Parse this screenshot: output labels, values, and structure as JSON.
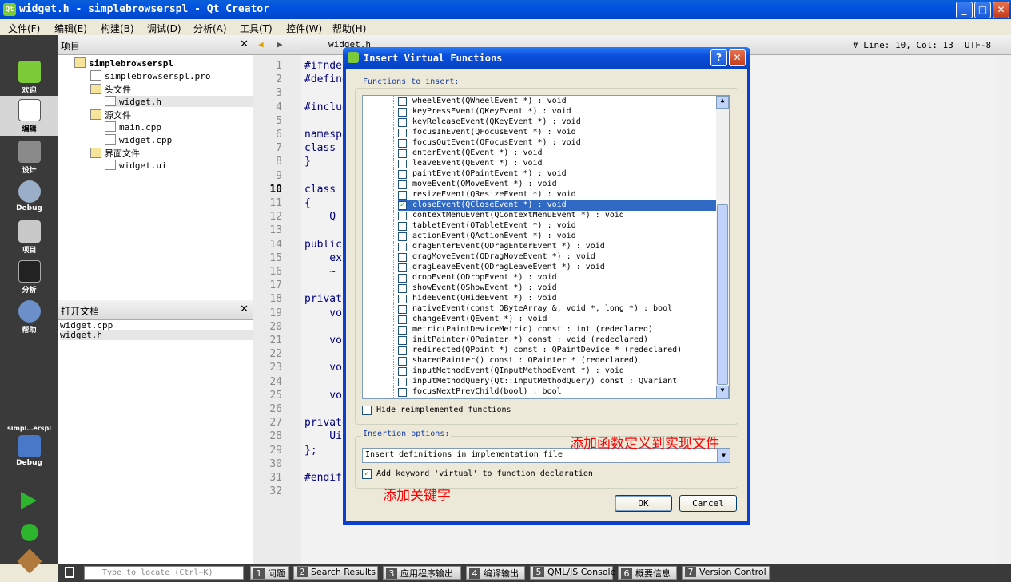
{
  "window": {
    "title": "widget.h - simplebrowserspl - Qt Creator",
    "icon": "qt-icon"
  },
  "menu": [
    "文件(F)",
    "编辑(E)",
    "构建(B)",
    "调试(D)",
    "分析(A)",
    "工具(T)",
    "控件(W)",
    "帮助(H)"
  ],
  "modes": [
    {
      "label": "欢迎",
      "icon": "welcome-icon"
    },
    {
      "label": "编辑",
      "icon": "edit-icon"
    },
    {
      "label": "设计",
      "icon": "design-icon"
    },
    {
      "label": "Debug",
      "icon": "debug-icon"
    },
    {
      "label": "项目",
      "icon": "project-icon"
    },
    {
      "label": "分析",
      "icon": "analyze-icon"
    },
    {
      "label": "帮助",
      "icon": "help-icon"
    }
  ],
  "target": {
    "name": "simpl…erspl",
    "mode": "Debug"
  },
  "projects": {
    "title": "项目",
    "tree": [
      {
        "label": "simplebrowserspl",
        "level": 0
      },
      {
        "label": "simplebrowserspl.pro",
        "level": 1
      },
      {
        "label": "头文件",
        "level": 1
      },
      {
        "label": "widget.h",
        "level": 2
      },
      {
        "label": "源文件",
        "level": 1
      },
      {
        "label": "main.cpp",
        "level": 2
      },
      {
        "label": "widget.cpp",
        "level": 2
      },
      {
        "label": "界面文件",
        "level": 1
      },
      {
        "label": "widget.ui",
        "level": 2
      }
    ]
  },
  "open_docs": {
    "title": "打开文档",
    "items": [
      "widget.cpp",
      "widget.h"
    ]
  },
  "editor": {
    "file": "widget.h",
    "status": "# Line: 10, Col: 13",
    "encoding": "UTF-8",
    "lines": [
      {
        "n": "1",
        "t": "#ifndef"
      },
      {
        "n": "2",
        "t": "#define"
      },
      {
        "n": "3",
        "t": ""
      },
      {
        "n": "4",
        "t": "#include"
      },
      {
        "n": "5",
        "t": ""
      },
      {
        "n": "6",
        "t": "namespace"
      },
      {
        "n": "7",
        "t": "class"
      },
      {
        "n": "8",
        "t": "}"
      },
      {
        "n": "9",
        "t": ""
      },
      {
        "n": "10",
        "t": "class"
      },
      {
        "n": "11",
        "t": "{"
      },
      {
        "n": "12",
        "t": "    Q"
      },
      {
        "n": "13",
        "t": ""
      },
      {
        "n": "14",
        "t": "public"
      },
      {
        "n": "15",
        "t": "    ex"
      },
      {
        "n": "16",
        "t": "    ~"
      },
      {
        "n": "17",
        "t": ""
      },
      {
        "n": "18",
        "t": "private"
      },
      {
        "n": "19",
        "t": "    vo"
      },
      {
        "n": "20",
        "t": ""
      },
      {
        "n": "21",
        "t": "    vo"
      },
      {
        "n": "22",
        "t": ""
      },
      {
        "n": "23",
        "t": "    vo"
      },
      {
        "n": "24",
        "t": ""
      },
      {
        "n": "25",
        "t": "    vo"
      },
      {
        "n": "26",
        "t": ""
      },
      {
        "n": "27",
        "t": "private"
      },
      {
        "n": "28",
        "t": "    Ui"
      },
      {
        "n": "29",
        "t": "};"
      },
      {
        "n": "30",
        "t": ""
      },
      {
        "n": "31",
        "t": "#endif"
      },
      {
        "n": "32",
        "t": ""
      }
    ]
  },
  "dialog": {
    "title": "Insert Virtual Functions",
    "functions_label": "Functions to insert:",
    "functions": [
      {
        "t": "wheelEvent(QWheelEvent *) : void",
        "c": false
      },
      {
        "t": "keyPressEvent(QKeyEvent *) : void",
        "c": false
      },
      {
        "t": "keyReleaseEvent(QKeyEvent *) : void",
        "c": false
      },
      {
        "t": "focusInEvent(QFocusEvent *) : void",
        "c": false
      },
      {
        "t": "focusOutEvent(QFocusEvent *) : void",
        "c": false
      },
      {
        "t": "enterEvent(QEvent *) : void",
        "c": false
      },
      {
        "t": "leaveEvent(QEvent *) : void",
        "c": false
      },
      {
        "t": "paintEvent(QPaintEvent *) : void",
        "c": false
      },
      {
        "t": "moveEvent(QMoveEvent *) : void",
        "c": false
      },
      {
        "t": "resizeEvent(QResizeEvent *) : void",
        "c": false
      },
      {
        "t": "closeEvent(QCloseEvent *) : void",
        "c": true
      },
      {
        "t": "contextMenuEvent(QContextMenuEvent *) : void",
        "c": false
      },
      {
        "t": "tabletEvent(QTabletEvent *) : void",
        "c": false
      },
      {
        "t": "actionEvent(QActionEvent *) : void",
        "c": false
      },
      {
        "t": "dragEnterEvent(QDragEnterEvent *) : void",
        "c": false
      },
      {
        "t": "dragMoveEvent(QDragMoveEvent *) : void",
        "c": false
      },
      {
        "t": "dragLeaveEvent(QDragLeaveEvent *) : void",
        "c": false
      },
      {
        "t": "dropEvent(QDropEvent *) : void",
        "c": false
      },
      {
        "t": "showEvent(QShowEvent *) : void",
        "c": false
      },
      {
        "t": "hideEvent(QHideEvent *) : void",
        "c": false
      },
      {
        "t": "nativeEvent(const QByteArray &, void *, long *) : bool",
        "c": false
      },
      {
        "t": "changeEvent(QEvent *) : void",
        "c": false
      },
      {
        "t": "metric(PaintDeviceMetric) const : int (redeclared)",
        "c": false
      },
      {
        "t": "initPainter(QPainter *) const : void (redeclared)",
        "c": false
      },
      {
        "t": "redirected(QPoint *) const : QPaintDevice * (redeclared)",
        "c": false
      },
      {
        "t": "sharedPainter() const : QPainter * (redeclared)",
        "c": false
      },
      {
        "t": "inputMethodEvent(QInputMethodEvent *) : void",
        "c": false
      },
      {
        "t": "inputMethodQuery(Qt::InputMethodQuery) const : QVariant",
        "c": false
      },
      {
        "t": "focusNextPrevChild(bool) : bool",
        "c": false
      }
    ],
    "hide_label": "Hide reimplemented functions",
    "insertion_label": "Insertion options:",
    "insertion_value": "Insert definitions in implementation file",
    "virtual_label": "Add keyword 'virtual' to function declaration",
    "ok": "OK",
    "cancel": "Cancel",
    "note_definitions": "添加函数定义到实现文件",
    "note_keyword": "添加关键字"
  },
  "status": {
    "locator_placeholder": "Type to locate (Ctrl+K)",
    "tabs": [
      {
        "n": "1",
        "l": "问题"
      },
      {
        "n": "2",
        "l": "Search Results"
      },
      {
        "n": "3",
        "l": "应用程序输出"
      },
      {
        "n": "4",
        "l": "编译输出"
      },
      {
        "n": "5",
        "l": "QML/JS Console"
      },
      {
        "n": "6",
        "l": "概要信息"
      },
      {
        "n": "7",
        "l": "Version Control"
      }
    ]
  }
}
